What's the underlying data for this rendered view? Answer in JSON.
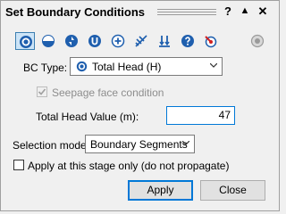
{
  "window": {
    "title": "Set Boundary Conditions"
  },
  "titlebar_buttons": [
    {
      "name": "help-button",
      "label": "?"
    },
    {
      "name": "collapse-button",
      "label": "▲"
    },
    {
      "name": "close-button",
      "label": "✕"
    }
  ],
  "toolbar": {
    "buttons": [
      "total-head-icon",
      "pressure-head-icon",
      "seepage-face-icon",
      "unknown-bc-icon",
      "add-flow-icon",
      "infiltration-icon",
      "drain-icon",
      "query-icon",
      "zero-pressure-icon",
      "disabled-bc-icon"
    ],
    "selected_index": 0
  },
  "bc_type": {
    "label": "BC Type:",
    "value": "Total Head (H)"
  },
  "seepage": {
    "label": "Seepage face condition",
    "checked": true,
    "disabled": true
  },
  "total_head": {
    "label": "Total Head Value (m):",
    "value": "47"
  },
  "selection_mode": {
    "label": "Selection mode:",
    "value": "Boundary Segments"
  },
  "stage_only": {
    "label": "Apply at this stage only (do not propagate)",
    "checked": false
  },
  "actions": {
    "apply": "Apply",
    "close": "Close"
  },
  "colors": {
    "accent": "#0078d7",
    "icon_blue": "#1f5fae",
    "selected_bg": "#cce4f7"
  }
}
